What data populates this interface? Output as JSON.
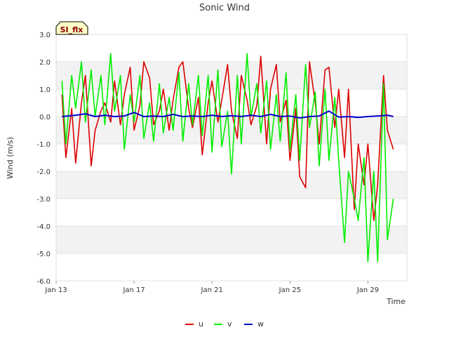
{
  "chart_data": {
    "type": "line",
    "title": "Sonic Wind",
    "xlabel": "Time",
    "ylabel": "Wind (m/s)",
    "badge": "SI_flx",
    "ylim": [
      -6.0,
      3.0
    ],
    "yticks": [
      -6.0,
      -5.0,
      -4.0,
      -3.0,
      -2.0,
      -1.0,
      0.0,
      1.0,
      2.0,
      3.0
    ],
    "ytick_labels": [
      "-6.0",
      "-5.0",
      "-4.0",
      "-3.0",
      "-2.0",
      "-1.0",
      "0.0",
      "1.0",
      "2.0",
      "3.0"
    ],
    "xlim": [
      "Jan 13",
      "Jan 31"
    ],
    "xtick_labels": [
      "Jan 13",
      "Jan 17",
      "Jan 21",
      "Jan 25",
      "Jan 29"
    ],
    "grid": "alternating horizontal bands",
    "legend_position": "bottom-center",
    "series": [
      {
        "name": "u",
        "color": "#dd0000",
        "x": [
          13.3,
          13.5,
          13.8,
          14.0,
          14.3,
          14.5,
          14.8,
          15.0,
          15.3,
          15.5,
          15.8,
          16.0,
          16.3,
          16.5,
          16.8,
          17.0,
          17.3,
          17.5,
          17.8,
          18.0,
          18.3,
          18.5,
          18.8,
          19.0,
          19.3,
          19.5,
          19.8,
          20.0,
          20.3,
          20.5,
          20.8,
          21.0,
          21.3,
          21.5,
          21.8,
          22.0,
          22.3,
          22.5,
          22.8,
          23.0,
          23.3,
          23.5,
          23.8,
          24.0,
          24.3,
          24.5,
          24.8,
          25.0,
          25.3,
          25.5,
          25.8,
          26.0,
          26.3,
          26.5,
          26.8,
          27.0,
          27.3,
          27.5,
          27.8,
          28.0,
          28.3,
          28.5,
          28.8,
          29.0,
          29.3,
          29.5,
          29.8,
          30.0,
          30.3
        ],
        "values": [
          0.8,
          -1.5,
          0.3,
          -1.7,
          0.5,
          1.5,
          -1.8,
          -0.5,
          0.2,
          0.5,
          -0.2,
          1.3,
          -0.3,
          0.8,
          1.8,
          -0.5,
          0.4,
          2.0,
          1.4,
          -0.3,
          0.2,
          1.0,
          -0.5,
          0.6,
          1.8,
          2.0,
          0.3,
          -0.4,
          0.7,
          -1.4,
          0.5,
          1.3,
          -0.2,
          0.6,
          1.9,
          0.2,
          -0.8,
          1.5,
          0.6,
          -0.3,
          0.4,
          2.2,
          -1.0,
          1.0,
          1.9,
          -0.2,
          0.6,
          -1.6,
          0.3,
          -2.2,
          -2.6,
          2.0,
          0.5,
          -1.0,
          1.7,
          1.8,
          -0.4,
          1.0,
          -1.5,
          1.0,
          -3.4,
          -1.0,
          -2.5,
          -1.0,
          -3.8,
          -2.5,
          1.5,
          -0.5,
          -1.2
        ]
      },
      {
        "name": "v",
        "color": "#00ee00",
        "x": [
          13.3,
          13.5,
          13.8,
          14.0,
          14.3,
          14.5,
          14.8,
          15.0,
          15.3,
          15.5,
          15.8,
          16.0,
          16.3,
          16.5,
          16.8,
          17.0,
          17.3,
          17.5,
          17.8,
          18.0,
          18.3,
          18.5,
          18.8,
          19.0,
          19.3,
          19.5,
          19.8,
          20.0,
          20.3,
          20.5,
          20.8,
          21.0,
          21.3,
          21.5,
          21.8,
          22.0,
          22.3,
          22.5,
          22.8,
          23.0,
          23.3,
          23.5,
          23.8,
          24.0,
          24.3,
          24.5,
          24.8,
          25.0,
          25.3,
          25.5,
          25.8,
          26.0,
          26.3,
          26.5,
          26.8,
          27.0,
          27.3,
          27.5,
          27.8,
          28.0,
          28.3,
          28.5,
          28.8,
          29.0,
          29.3,
          29.5,
          29.8,
          30.0,
          30.3
        ],
        "values": [
          1.3,
          -1.0,
          1.5,
          0.3,
          2.0,
          -0.2,
          1.7,
          0.0,
          1.5,
          -0.3,
          2.3,
          0.2,
          1.5,
          -1.2,
          0.8,
          -0.2,
          1.5,
          -0.8,
          0.5,
          -0.9,
          1.2,
          -0.6,
          0.7,
          -0.5,
          1.6,
          -0.9,
          1.2,
          -0.3,
          1.5,
          -0.7,
          1.5,
          -1.3,
          1.7,
          -1.1,
          0.2,
          -2.1,
          1.5,
          -1.0,
          2.3,
          0.0,
          1.2,
          -0.6,
          1.3,
          -1.2,
          0.8,
          -0.9,
          1.6,
          -1.2,
          0.8,
          -1.6,
          1.9,
          -0.4,
          0.9,
          -1.8,
          1.0,
          -1.6,
          0.7,
          -1.6,
          -4.6,
          -2.0,
          -3.0,
          -3.8,
          -1.5,
          -5.3,
          -2.0,
          -5.3,
          1.2,
          -4.5,
          -3.0
        ]
      },
      {
        "name": "w",
        "color": "#0000cc",
        "x": [
          13.3,
          14.0,
          14.5,
          15.0,
          15.5,
          16.0,
          16.5,
          17.0,
          17.5,
          18.0,
          18.5,
          19.0,
          19.5,
          20.0,
          20.5,
          21.0,
          21.5,
          22.0,
          22.5,
          23.0,
          23.5,
          24.0,
          24.5,
          25.0,
          25.5,
          26.0,
          26.5,
          27.0,
          27.5,
          28.0,
          28.5,
          29.0,
          29.5,
          30.0,
          30.3
        ],
        "values": [
          0.0,
          0.05,
          0.1,
          0.0,
          0.05,
          0.0,
          0.02,
          0.15,
          0.0,
          0.02,
          0.0,
          0.08,
          0.0,
          0.02,
          0.0,
          0.05,
          0.0,
          0.03,
          0.0,
          0.05,
          0.0,
          0.08,
          0.0,
          0.02,
          -0.05,
          0.0,
          0.02,
          0.2,
          -0.02,
          0.0,
          -0.03,
          0.0,
          0.02,
          0.05,
          0.0
        ]
      }
    ]
  }
}
